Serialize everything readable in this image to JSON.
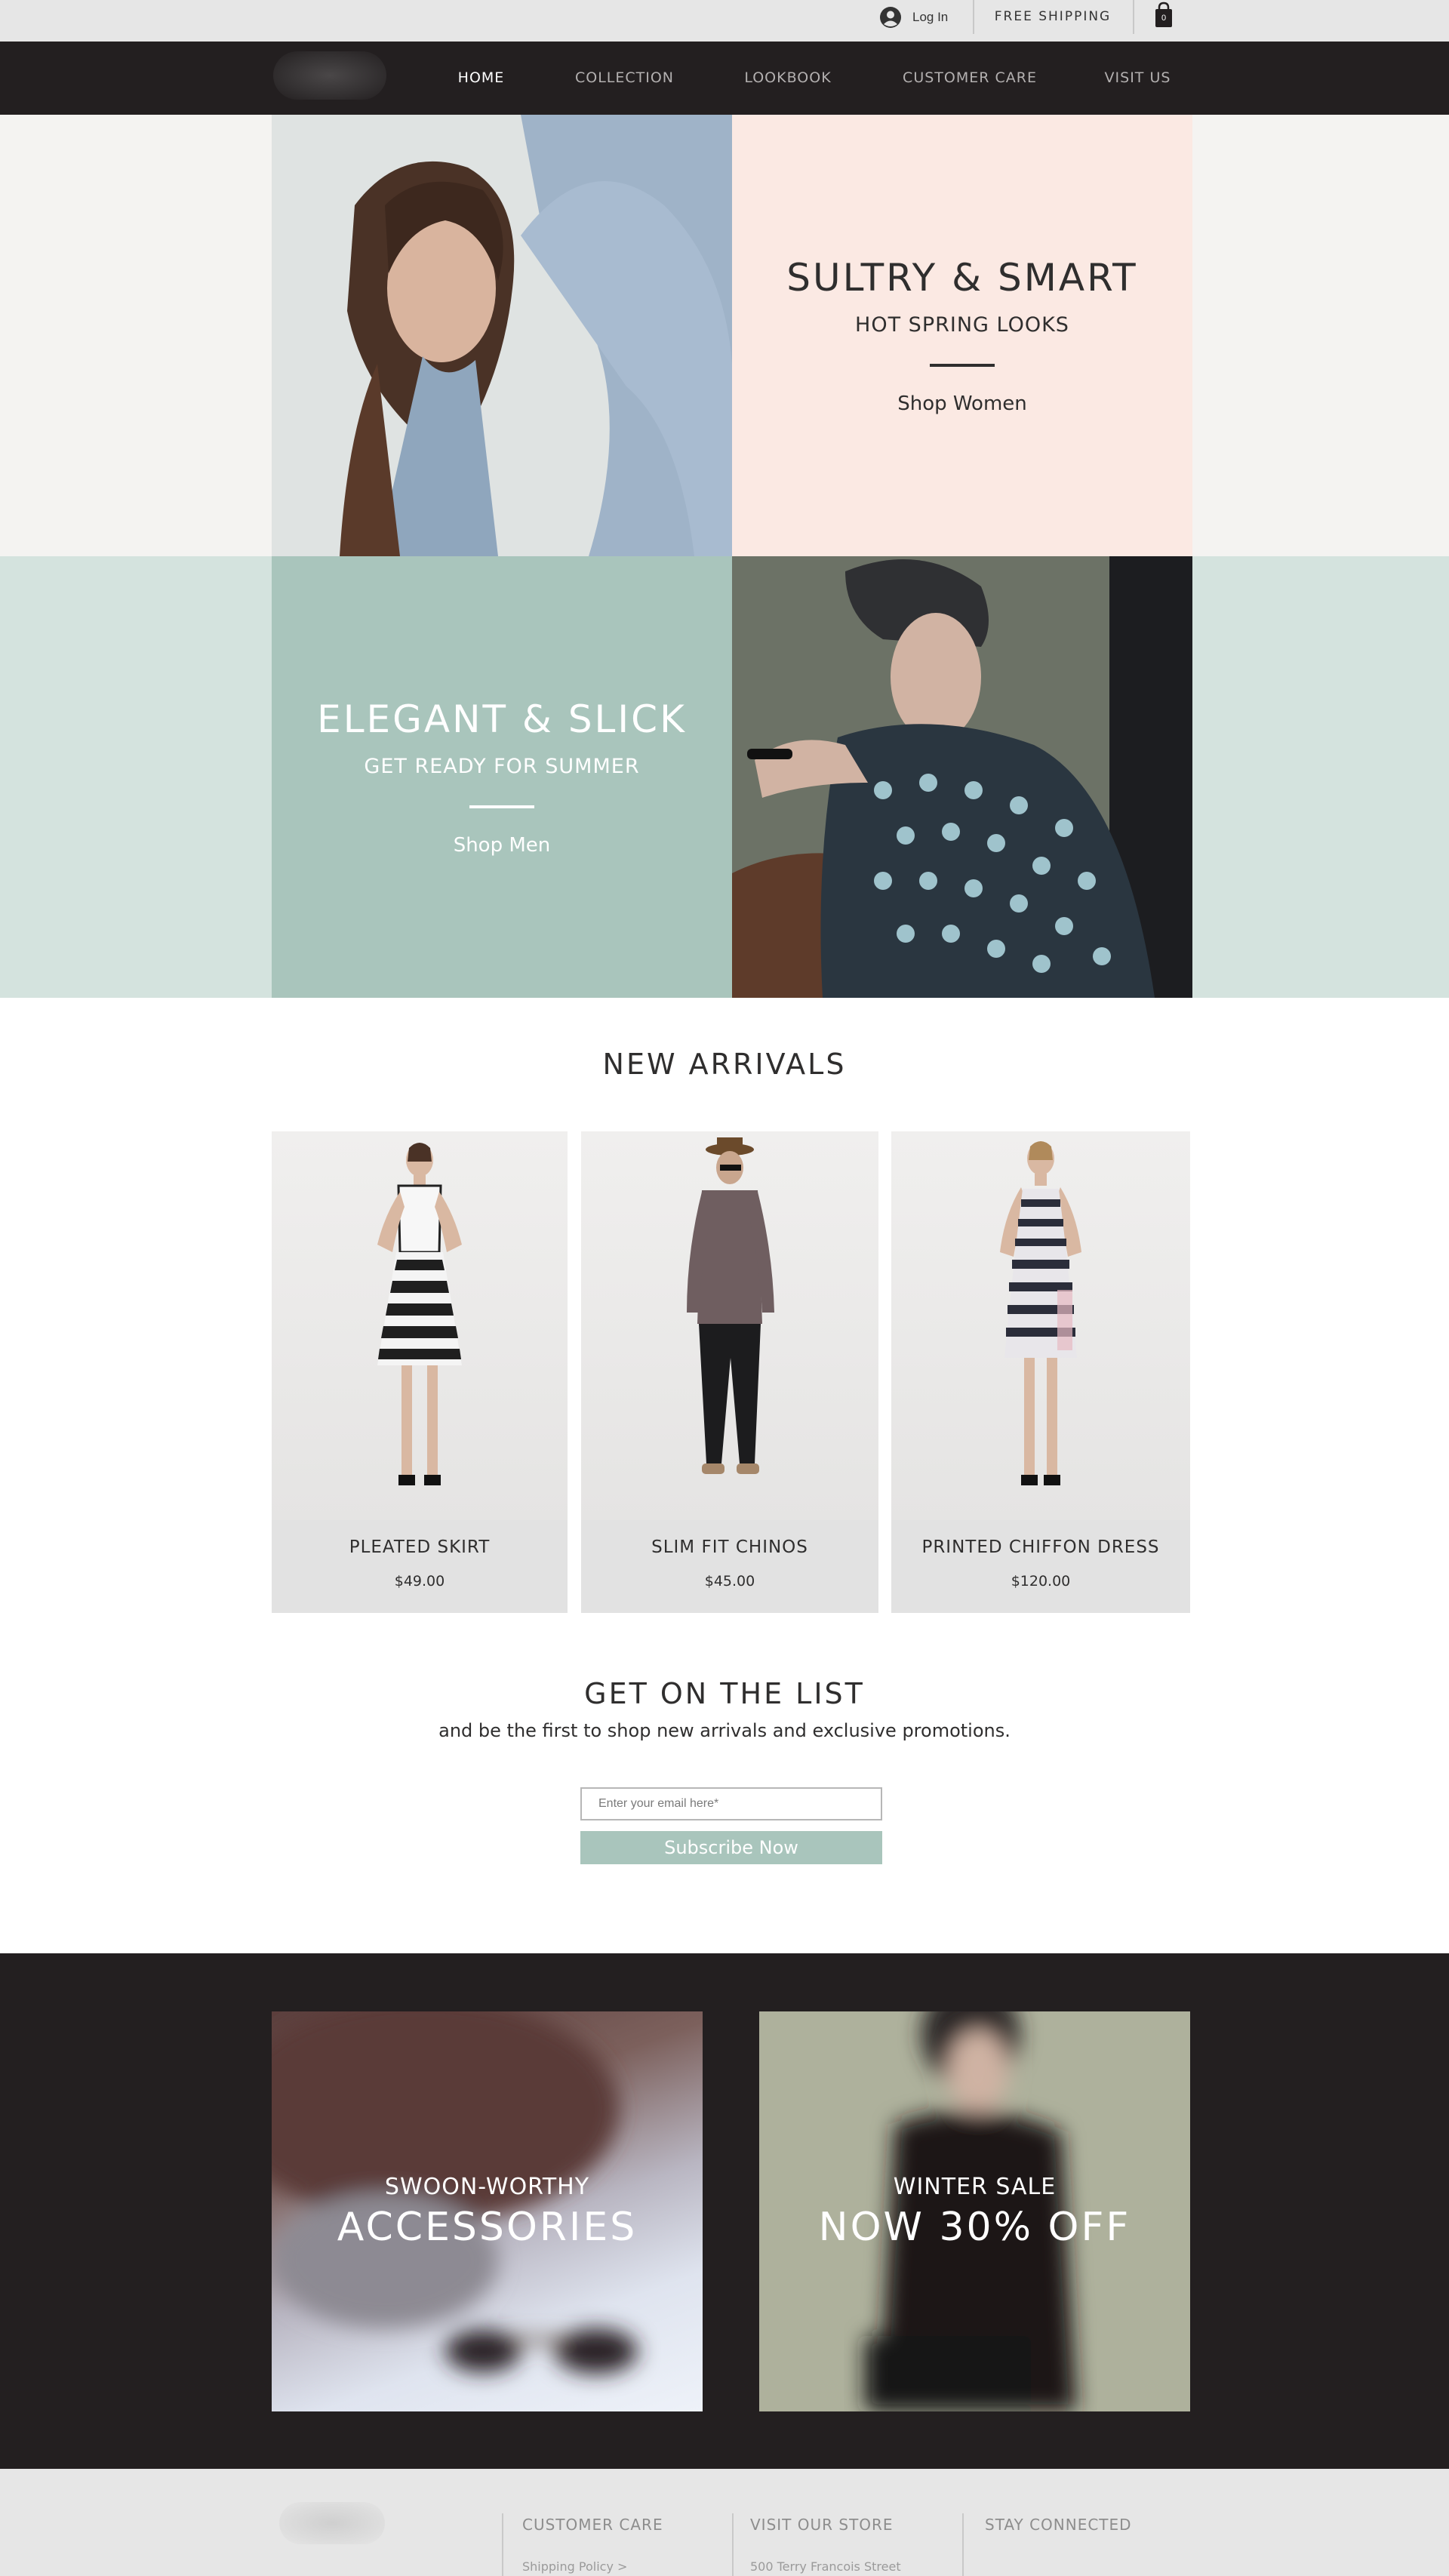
{
  "topbar": {
    "login_label": "Log In",
    "free_shipping": "FREE SHIPPING",
    "cart_count": "0"
  },
  "nav": {
    "items": [
      {
        "label": "HOME",
        "active": true
      },
      {
        "label": "COLLECTION",
        "active": false
      },
      {
        "label": "LOOKBOOK",
        "active": false
      },
      {
        "label": "CUSTOMER CARE",
        "active": false
      },
      {
        "label": "VISIT US",
        "active": false
      }
    ]
  },
  "hero": {
    "women": {
      "title": "SULTRY & SMART",
      "subtitle": "HOT SPRING LOOKS",
      "link": "Shop Women"
    },
    "men": {
      "title": "ELEGANT & SLICK",
      "subtitle": "GET READY FOR SUMMER",
      "link": "Shop Men"
    }
  },
  "new_arrivals": {
    "title": "NEW ARRIVALS",
    "products": [
      {
        "name": "PLEATED SKIRT",
        "price": "$49.00"
      },
      {
        "name": "SLIM FIT CHINOS",
        "price": "$45.00"
      },
      {
        "name": "PRINTED CHIFFON DRESS",
        "price": "$120.00"
      }
    ]
  },
  "newsletter": {
    "title": "GET ON THE LIST",
    "subtitle": "and be the first to shop new arrivals and exclusive promotions.",
    "email_placeholder": "Enter your email here*",
    "button_label": "Subscribe Now"
  },
  "promos": {
    "accessories": {
      "overline": "SWOON-WORTHY",
      "title": "ACCESSORIES"
    },
    "sale": {
      "overline": "WINTER SALE",
      "title": "NOW 30% OFF"
    }
  },
  "footer": {
    "customer_care": {
      "heading": "CUSTOMER CARE",
      "link": "Shipping Policy >"
    },
    "visit_store": {
      "heading": "VISIT OUR STORE",
      "address": "500 Terry Francois Street"
    },
    "stay_connected": {
      "heading": "STAY CONNECTED"
    }
  },
  "colors": {
    "nav_bg": "#231f20",
    "pink_panel": "#fbe9e3",
    "teal_panel": "#a9c5bc",
    "teal_band": "#d4e3de",
    "product_card": "#e2e2e2",
    "footer_bg": "#e6e6e6"
  },
  "icons": {
    "login": "user-circle-icon",
    "cart": "shopping-bag-icon"
  }
}
